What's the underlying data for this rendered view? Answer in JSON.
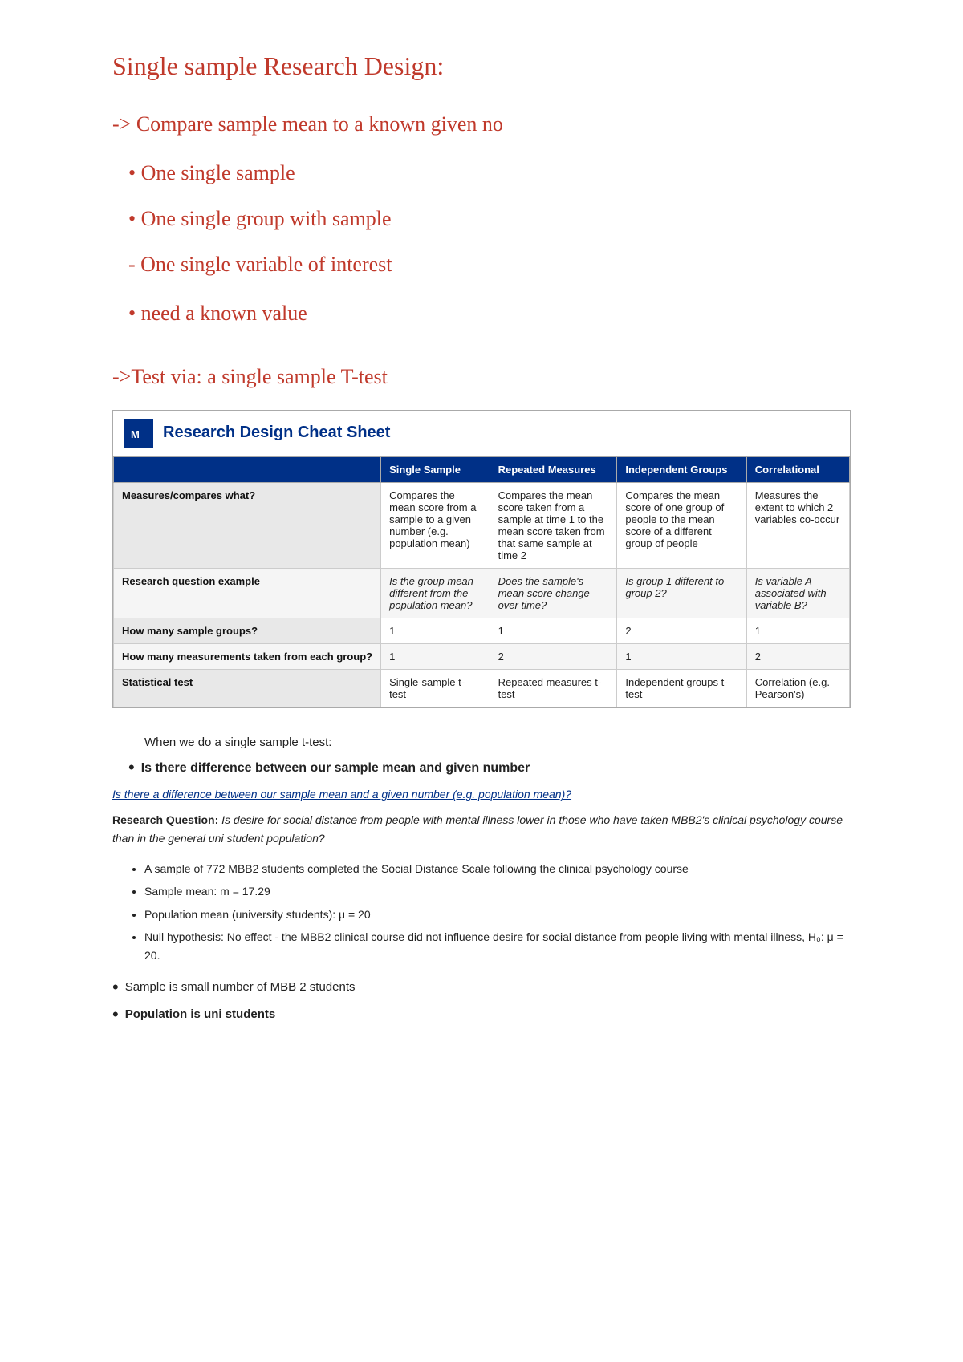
{
  "title": "Single sample Research Design:",
  "lines": [
    "-> Compare sample mean to a known given no",
    "• One single sample",
    "• One single group with sample",
    "- One single variable of interest",
    "• need a known value"
  ],
  "test_line": "->Test via: a single sample T-test",
  "cheat_sheet": {
    "title": "Research Design Cheat Sheet",
    "columns": [
      "",
      "Single Sample",
      "Repeated Measures",
      "Independent Groups",
      "Correlational"
    ],
    "rows": [
      {
        "label": "Measures/compares what?",
        "single": "Compares the mean score from a sample to a given number (e.g. population mean)",
        "repeated": "Compares the mean score taken from a sample at time 1 to the mean score taken from that same sample at time 2",
        "independent": "Compares the mean score of one group of people to the mean score of a different group of people",
        "correlational": "Measures the extent to which 2 variables co-occur"
      },
      {
        "label": "Research question example",
        "single": "Is the group mean different from the population mean?",
        "repeated": "Does the sample's mean score change over time?",
        "independent": "Is group 1 different to group 2?",
        "correlational": "Is variable A associated with variable B?"
      },
      {
        "label": "How many sample groups?",
        "single": "1",
        "repeated": "1",
        "independent": "2",
        "correlational": "1"
      },
      {
        "label": "How many measurements taken from each group?",
        "single": "1",
        "repeated": "2",
        "independent": "1",
        "correlational": "2"
      },
      {
        "label": "Statistical test",
        "single": "Single-sample t-test",
        "repeated": "Repeated measures t-test",
        "independent": "Independent groups t-test",
        "correlational": "Correlation (e.g. Pearson's)"
      }
    ]
  },
  "typed_section": {
    "when_line": "When we do a single sample t-test:",
    "bullet_bold": "Is there difference between our sample mean and given number",
    "italic_question": "Is there a difference between our sample mean and a given number (e.g. population mean)?",
    "research_question_label": "Research Question:",
    "research_question_text": "Is desire for social distance from people with mental illness lower in those who have taken MBB2's clinical psychology course than in the general uni student population?",
    "bullet_items": [
      "A sample of 772 MBB2 students completed the Social Distance Scale following the clinical psychology course",
      "Sample mean: m = 17.29",
      "Population mean (university students): μ = 20",
      "Null hypothesis: No effect - the MBB2 clinical course did not influence desire for social distance from people living with mental illness, H₀: μ = 20."
    ],
    "bottom_bullets": [
      "Sample is small number of MBB 2 students",
      "Population is uni students"
    ]
  }
}
